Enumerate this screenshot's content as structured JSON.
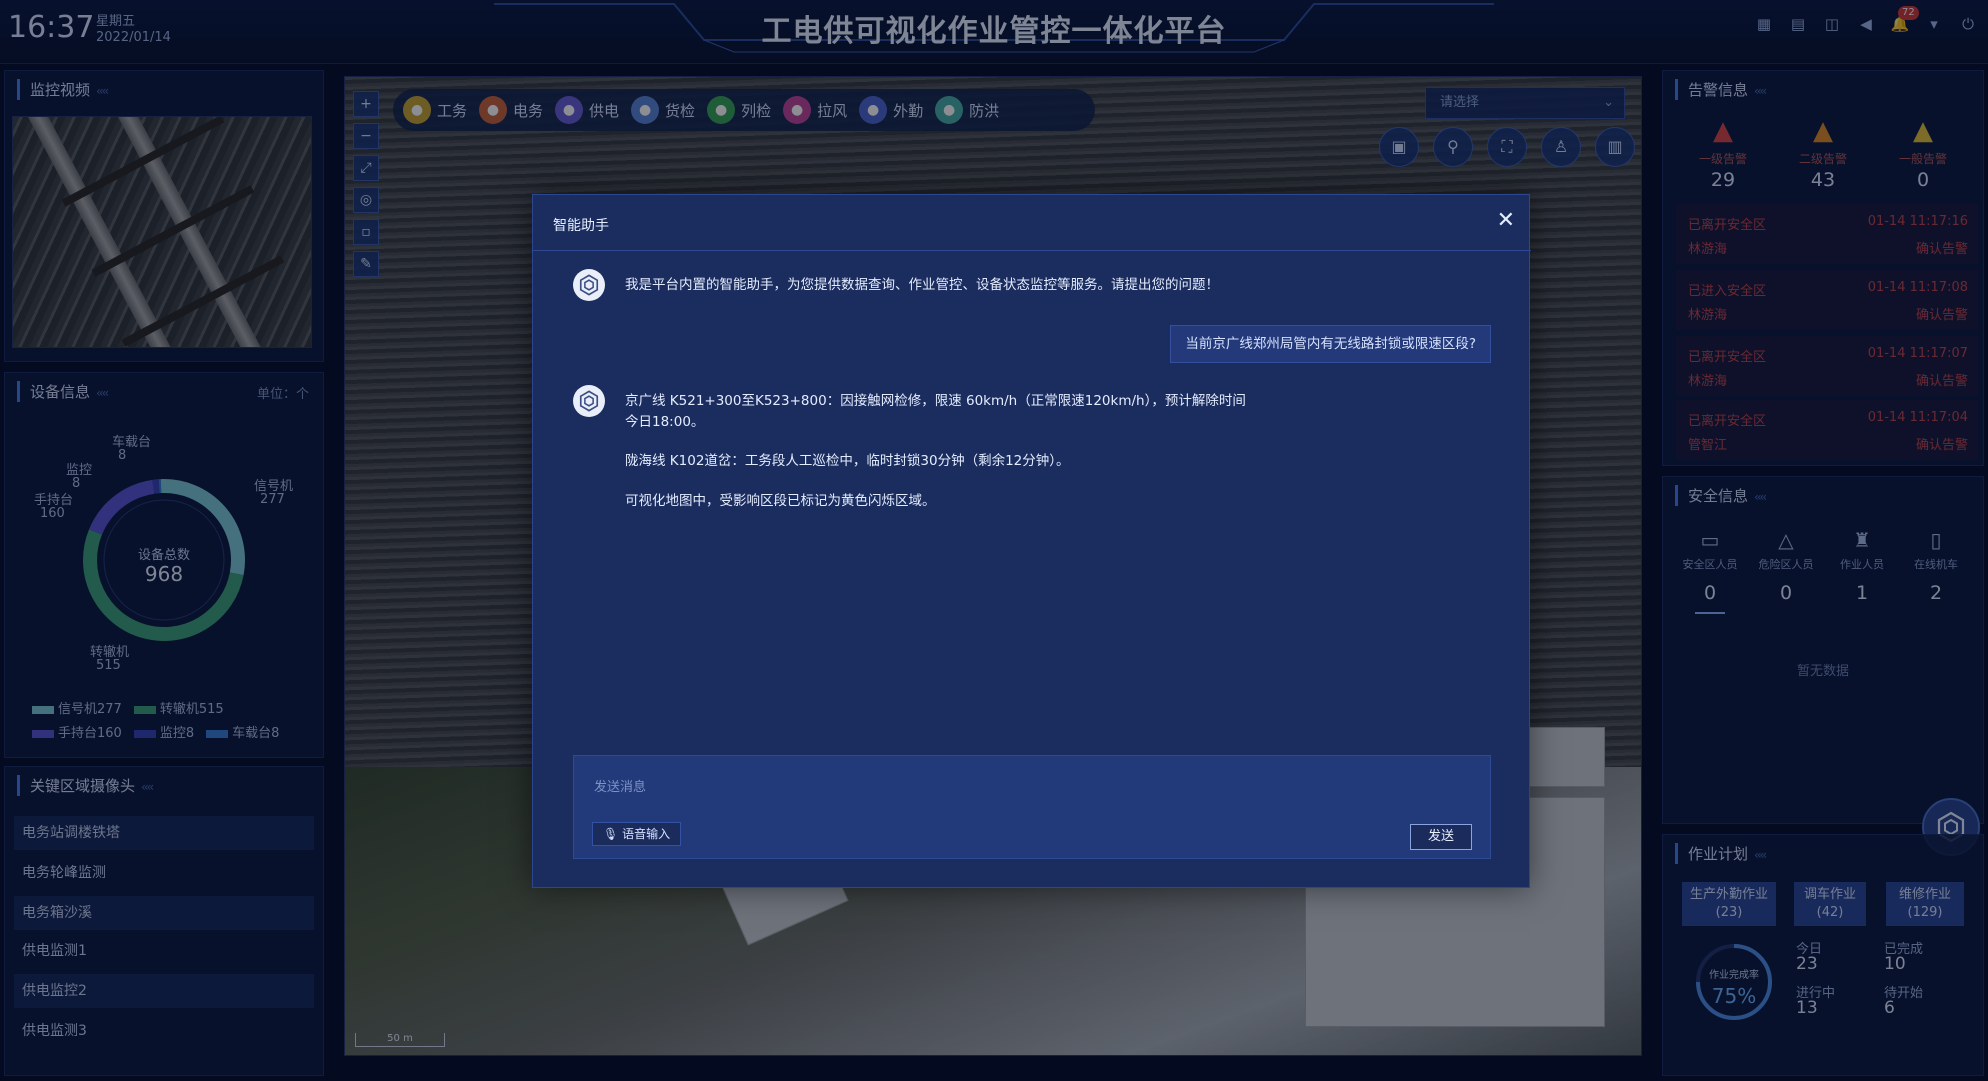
{
  "header": {
    "time": "16:37",
    "weekday": "星期五",
    "date": "2022/01/14",
    "title": "工电供可视化作业管控一体化平台",
    "notification_count": "72"
  },
  "monitor_video": {
    "title": "监控视频"
  },
  "device_info": {
    "title": "设备信息",
    "unit": "单位：个",
    "center_label": "设备总数",
    "total": "968",
    "chart_data": {
      "type": "pie",
      "title": "",
      "categories": [
        "信号机",
        "转辙机",
        "手持台",
        "监控",
        "车载台"
      ],
      "values": [
        277,
        515,
        160,
        8,
        8
      ],
      "colors": [
        "#7fc8d6",
        "#3fa37a",
        "#5b57d6",
        "#3a44b8",
        "#3d7fd9"
      ],
      "labels": [
        {
          "name": "信号机",
          "value": "277"
        },
        {
          "name": "转辙机",
          "value": "515"
        },
        {
          "name": "手持台",
          "value": "160"
        },
        {
          "name": "监控",
          "value": "8"
        },
        {
          "name": "车载台",
          "value": "8"
        }
      ],
      "legend": [
        "信号机277",
        "转辙机515",
        "手持台160",
        "监控8",
        "车载台8"
      ]
    }
  },
  "key_cameras": {
    "title": "关键区域摄像头",
    "items": [
      "电务站调楼铁塔",
      "电务轮峰监测",
      "电务箱沙溪",
      "供电监测1",
      "供电监控2",
      "供电监测3"
    ]
  },
  "map": {
    "layers": [
      "工务",
      "电务",
      "供电",
      "货检",
      "列检",
      "拉风",
      "外勤",
      "防洪"
    ],
    "layer_colors": [
      "#c9a436",
      "#c8643d",
      "#6b5fd6",
      "#5b86d9",
      "#3aa65a",
      "#c2489c",
      "#4e67cf",
      "#4bb0a9"
    ],
    "select_placeholder": "请选择",
    "scale_label": "50 m"
  },
  "dialog": {
    "title": "智能助手",
    "bot_intro": "我是平台内置的智能助手，为您提供数据查询、作业管控、设备状态监控等服务。请提出您的问题！",
    "user_question": "当前京广线郑州局管内有无线路封锁或限速区段?",
    "bot_reply_line1": "京广线 K521+300至K523+800：因接触网检修，限速 60km/h（正常限速120km/h），预计解除时间",
    "bot_reply_line2": "今日18:00。",
    "bot_reply_line3": "陇海线 K102道岔：工务段人工巡检中，临时封锁30分钟（剩余12分钟）。",
    "bot_reply_line4": "可视化地图中，受影响区段已标记为黄色闪烁区域。",
    "input_placeholder": "发送消息",
    "voice_label": "语音输入",
    "send_label": "发送"
  },
  "alarm_info": {
    "title": "告警信息",
    "levels": [
      {
        "label": "一级告警",
        "count": "29",
        "color": "#d84a4a"
      },
      {
        "label": "二级告警",
        "count": "43",
        "color": "#e08a2a"
      },
      {
        "label": "一般告警",
        "count": "0",
        "color": "#e2c23a"
      }
    ],
    "items": [
      {
        "event": "已离开安全区",
        "time": "01-14 11:17:16",
        "person": "林游海",
        "action": "确认告警"
      },
      {
        "event": "已进入安全区",
        "time": "01-14 11:17:08",
        "person": "林游海",
        "action": "确认告警"
      },
      {
        "event": "已离开安全区",
        "time": "01-14 11:17:07",
        "person": "林游海",
        "action": "确认告警"
      },
      {
        "event": "已离开安全区",
        "time": "01-14 11:17:04",
        "person": "管智江",
        "action": "确认告警"
      }
    ]
  },
  "safety_info": {
    "title": "安全信息",
    "items": [
      {
        "label": "安全区人员",
        "value": "0"
      },
      {
        "label": "危险区人员",
        "value": "0"
      },
      {
        "label": "作业人员",
        "value": "1"
      },
      {
        "label": "在线机车",
        "value": "2"
      }
    ],
    "empty_text": "暂无数据"
  },
  "work_plan": {
    "title": "作业计划",
    "buttons": [
      "生产外勤作业(23)",
      "调车作业(42)",
      "维修作业(129)"
    ],
    "completion_label": "作业完成率",
    "completion_rate": "75%",
    "completion_value": 0.75,
    "stats": [
      {
        "label": "今日",
        "value": "23"
      },
      {
        "label": "已完成",
        "value": "10"
      },
      {
        "label": "进行中",
        "value": "13"
      },
      {
        "label": "待开始",
        "value": "6"
      }
    ]
  }
}
